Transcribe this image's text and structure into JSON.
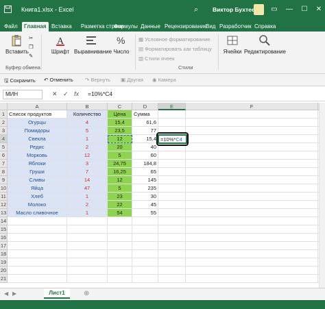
{
  "window": {
    "title": "Книга1.xlsx - Excel",
    "user": "Виктор Бухтеев",
    "minimize_glyph": "—",
    "maximize_glyph": "☐",
    "close_glyph": "✕",
    "search_glyph": "⌕",
    "ribbon_toggle_glyph": "▭"
  },
  "qat_icons": [
    "save-icon",
    "undo-icon",
    "redo-icon"
  ],
  "tabs": [
    "Файл",
    "Главная",
    "Вставка",
    "Разметка страни",
    "Формулы",
    "Данные",
    "Рецензирование",
    "Вид",
    "Разработчик",
    "Справка"
  ],
  "active_tab": 1,
  "ribbon": {
    "paste": "Вставить",
    "clipboard_group": "Буфер обмена",
    "font": "Шрифт",
    "alignment": "Выравнивание",
    "number": "Число",
    "conditional_formatting": "Условное форматирование",
    "format_as_table": "Форматировать как таблицу",
    "cell_styles": "Стили ячеек",
    "styles_group": "Стили",
    "cells": "Ячейки",
    "editing": "Редактирование"
  },
  "quick_bar": {
    "save": "Сохранить",
    "undo": "Отменить",
    "redo": "Вернуть",
    "other": "Другая",
    "camera": "Камера"
  },
  "formula_bar": {
    "name_box": "МИН",
    "cancel": "✕",
    "enter": "✓",
    "fx": "fx",
    "formula": "=10%*C4"
  },
  "columns": [
    "A",
    "B",
    "C",
    "D",
    "E",
    "F",
    "G"
  ],
  "rows": [
    "1",
    "2",
    "3",
    "4",
    "5",
    "6",
    "7",
    "8",
    "9",
    "10",
    "11",
    "12",
    "13",
    "14",
    "15",
    "16",
    "17",
    "18",
    "19",
    "20",
    "21"
  ],
  "table": {
    "headers": [
      "Список продуктов",
      "Количество",
      "Цена",
      "Сумма"
    ],
    "products": [
      "Огурцы",
      "Помидоры",
      "Свекла",
      "Редис",
      "Морковь",
      "Яблоки",
      "Груши",
      "Сливы",
      "Яйца",
      "Хлеб",
      "Молоко",
      "Масло сливочное"
    ],
    "quantities": [
      "4",
      "5",
      "1",
      "2",
      "12",
      "3",
      "7",
      "14",
      "47",
      "1",
      "2",
      "1"
    ],
    "prices": [
      "15,4",
      "23,5",
      "12",
      "20",
      "5",
      "24,75",
      "16,25",
      "12",
      "5",
      "23",
      "22",
      "54"
    ],
    "sums": [
      "61,6",
      "77",
      "15,4",
      "40",
      "60",
      "184,8",
      "65",
      "145",
      "235",
      "30",
      "45",
      "55"
    ]
  },
  "active_cell": {
    "ref": "E4",
    "content": "=10%*",
    "ref_part": "C4"
  },
  "sheet": {
    "name": "Лист1"
  }
}
